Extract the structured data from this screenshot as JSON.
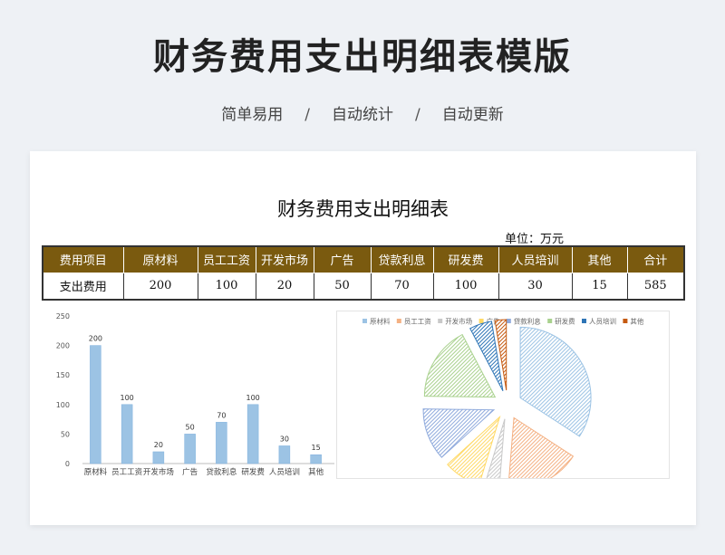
{
  "header": {
    "title": "财务费用支出明细表模版",
    "features": [
      "简单易用",
      "自动统计",
      "自动更新"
    ],
    "separator": "/"
  },
  "sheet": {
    "title": "财务费用支出明细表",
    "unit": "单位：万元",
    "columns": [
      "费用项目",
      "原材料",
      "员工工资",
      "开发市场",
      "广告",
      "贷款利息",
      "研发费",
      "人员培训",
      "其他",
      "合计"
    ],
    "row": [
      "支出费用",
      "200",
      "100",
      "20",
      "50",
      "70",
      "100",
      "30",
      "15",
      "585"
    ]
  },
  "colors": {
    "header_bg": "#7a5a0f",
    "bar": "#9cc3e4",
    "pie": [
      "#9cc3e4",
      "#f4b183",
      "#c9c9c9",
      "#ffd966",
      "#8faadc",
      "#a9d18e",
      "#2e75b6",
      "#c55a11"
    ]
  },
  "chart_data": [
    {
      "type": "bar",
      "categories": [
        "原材料",
        "员工工资",
        "开发市场",
        "广告",
        "贷款利息",
        "研发费",
        "人员培训",
        "其他"
      ],
      "values": [
        200,
        100,
        20,
        50,
        70,
        100,
        30,
        15
      ],
      "data_labels": [
        "200",
        "100",
        "20",
        "50",
        "70",
        "100",
        "30",
        "15"
      ],
      "ylim": [
        0,
        250
      ],
      "yticks": [
        "0",
        "50",
        "100",
        "150",
        "200",
        "250"
      ],
      "grid": false
    },
    {
      "type": "pie",
      "categories": [
        "原材料",
        "员工工资",
        "开发市场",
        "广告",
        "贷款利息",
        "研发费",
        "人员培训",
        "其他"
      ],
      "values": [
        200,
        100,
        20,
        50,
        70,
        100,
        30,
        15
      ],
      "legend": "top",
      "exploded": true
    }
  ]
}
